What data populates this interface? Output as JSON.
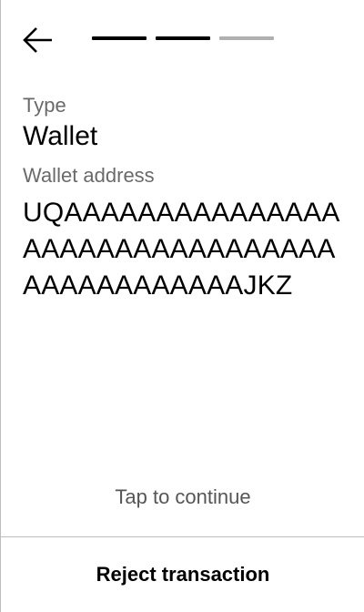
{
  "header": {
    "back_icon": "arrow-left-icon",
    "steps": [
      {
        "state": "complete"
      },
      {
        "state": "complete"
      },
      {
        "state": "pending"
      }
    ]
  },
  "details": {
    "type_label": "Type",
    "type_value": "Wallet",
    "address_label": "Wallet address",
    "address_value": "UQAAAAAAAAAAAAAAAAAAAAAAAAAAAAAAAAAAAAAAAAAAAAJKZ"
  },
  "actions": {
    "tap_hint": "Tap to continue",
    "reject_label": "Reject transaction"
  },
  "colors": {
    "text": "#000000",
    "muted_text": "#6a6a6a",
    "step_active": "#000000",
    "step_pending": "#b0b0b0",
    "divider": "#bdbdbd"
  }
}
